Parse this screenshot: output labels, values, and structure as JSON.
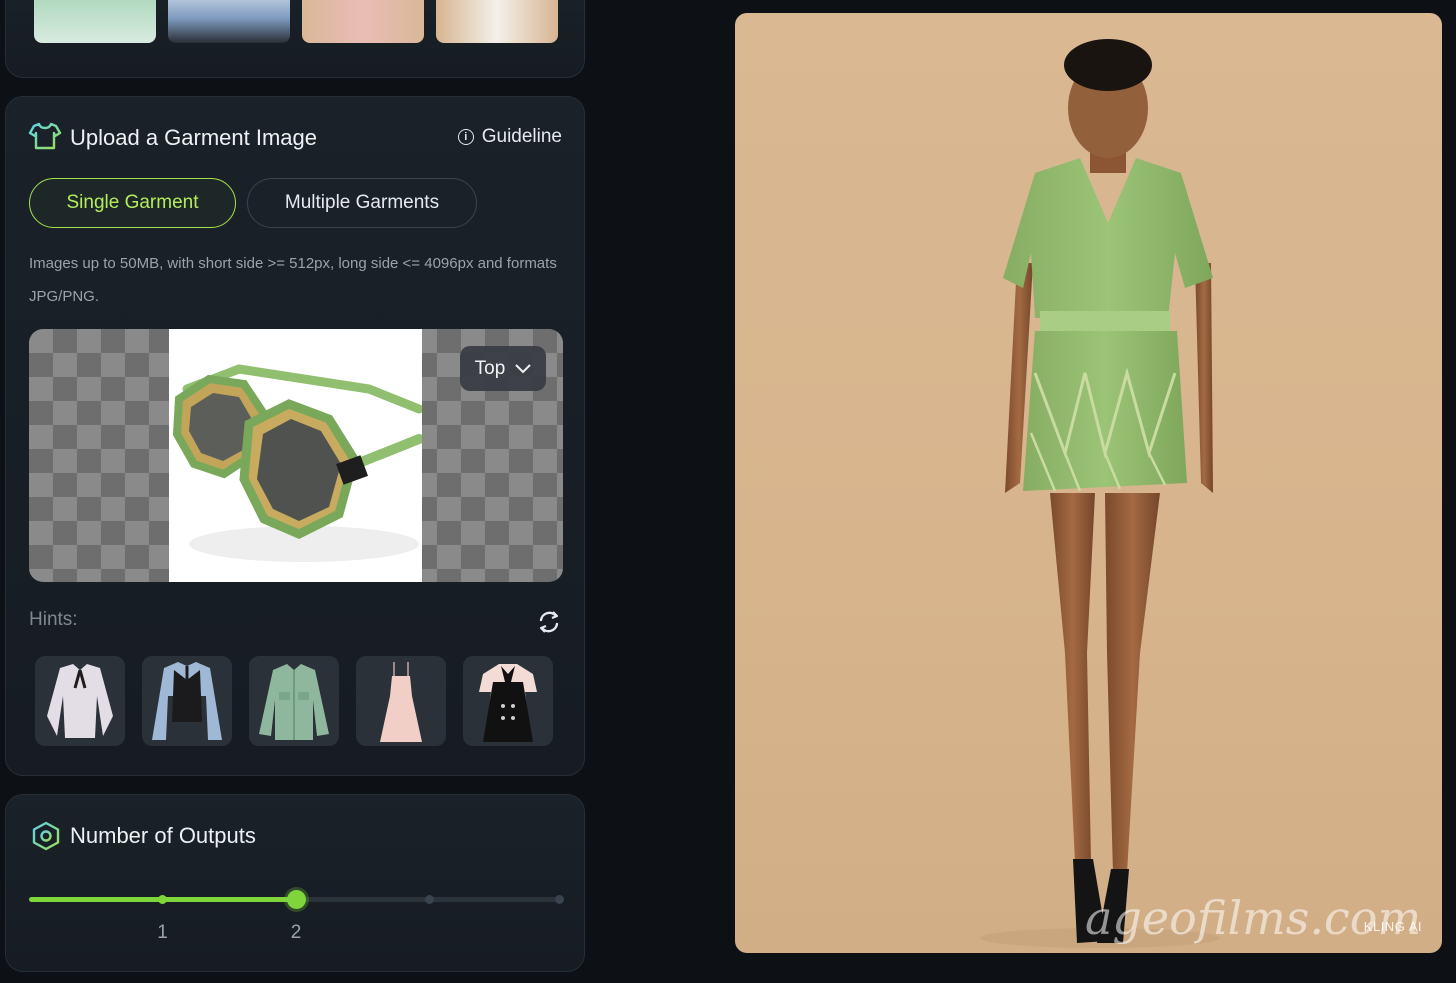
{
  "upload": {
    "title": "Upload a Garment Image",
    "guideline_label": "Guideline",
    "modes": [
      "Single Garment",
      "Multiple Garments"
    ],
    "active_mode": "Single Garment",
    "note": "Images up to 50MB, with short side >= 512px, long side <= 4096px and formats JPG/PNG.",
    "garment_type": "Top",
    "preview_icon": "sunglasses-garment-preview",
    "hints_label": "Hints:",
    "hints": [
      "white-blouse-icon",
      "vest-shirt-icon",
      "denim-jacket-icon",
      "pink-slip-dress-icon",
      "black-pinafore-dress-icon"
    ]
  },
  "outputs": {
    "title": "Number of Outputs",
    "ticks": [
      "1",
      "2",
      "",
      ""
    ],
    "value": 2,
    "max": 4
  },
  "result": {
    "image": "model-green-dress-result",
    "watermark": "ageofilms.com",
    "badge": "KLING AI"
  },
  "colors": {
    "accent": "#7ed63a",
    "active_outline": "#a4e24a",
    "background": "#0d1116",
    "panel": "#1a2128"
  }
}
